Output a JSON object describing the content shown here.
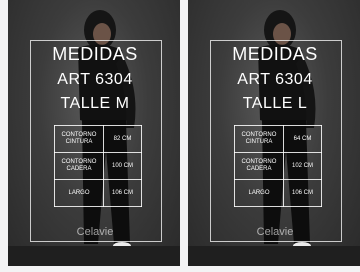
{
  "cards": [
    {
      "title": "MEDIDAS",
      "article": "ART 6304",
      "size": "TALLE M",
      "rows": [
        {
          "label": "CONTORNO CINTURA",
          "value": "82 CM"
        },
        {
          "label": "CONTORNO CADERA",
          "value": "100 CM"
        },
        {
          "label": "LARGO",
          "value": "106 CM"
        }
      ],
      "brand": "Celavie"
    },
    {
      "title": "MEDIDAS",
      "article": "ART 6304",
      "size": "TALLE L",
      "rows": [
        {
          "label": "CONTORNO CINTURA",
          "value": "64 CM"
        },
        {
          "label": "CONTORNO CADERA",
          "value": "102 CM"
        },
        {
          "label": "LARGO",
          "value": "106 CM"
        }
      ],
      "brand": "Celavie"
    }
  ]
}
